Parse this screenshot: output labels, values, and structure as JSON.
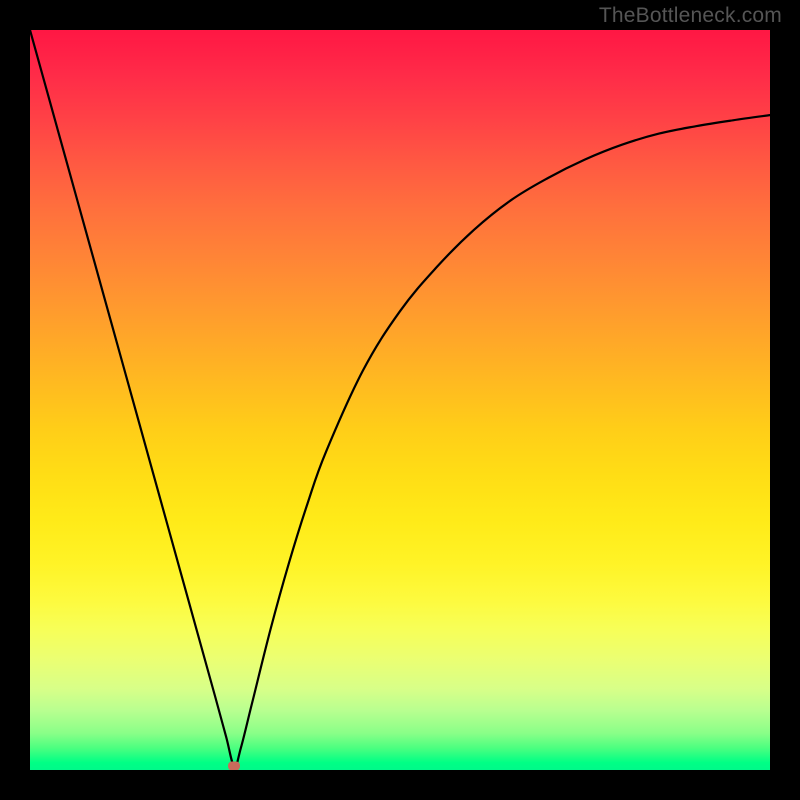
{
  "watermark": "TheBottleneck.com",
  "colors": {
    "black": "#000000",
    "gradient_top": "#ff1744",
    "gradient_bottom": "#00f98a",
    "curve": "#000000",
    "marker": "#c96b5b",
    "watermark_text": "#555555"
  },
  "chart_data": {
    "type": "line",
    "title": "",
    "xlabel": "",
    "ylabel": "",
    "xlim": [
      0,
      100
    ],
    "ylim": [
      0,
      100
    ],
    "grid": false,
    "legend": false,
    "background": "red-to-green vertical gradient",
    "series": [
      {
        "name": "bottleneck-curve",
        "x": [
          0,
          2.5,
          5,
          7.5,
          10,
          12.5,
          15,
          17.5,
          20,
          22.5,
          25,
          26.5,
          27.6,
          28.5,
          30,
          32.5,
          35,
          37.5,
          40,
          45,
          50,
          55,
          60,
          65,
          70,
          75,
          80,
          85,
          90,
          95,
          100
        ],
        "values": [
          100,
          91,
          82,
          73,
          64,
          55,
          46,
          37,
          28,
          19,
          10,
          4.5,
          0.5,
          3,
          9,
          19,
          28,
          36,
          43,
          54,
          62,
          68,
          73,
          77,
          80,
          82.5,
          84.5,
          86,
          87,
          87.8,
          88.5
        ]
      }
    ],
    "marker": {
      "x": 27.6,
      "y": 0.5,
      "color": "#c96b5b"
    },
    "annotations": []
  }
}
